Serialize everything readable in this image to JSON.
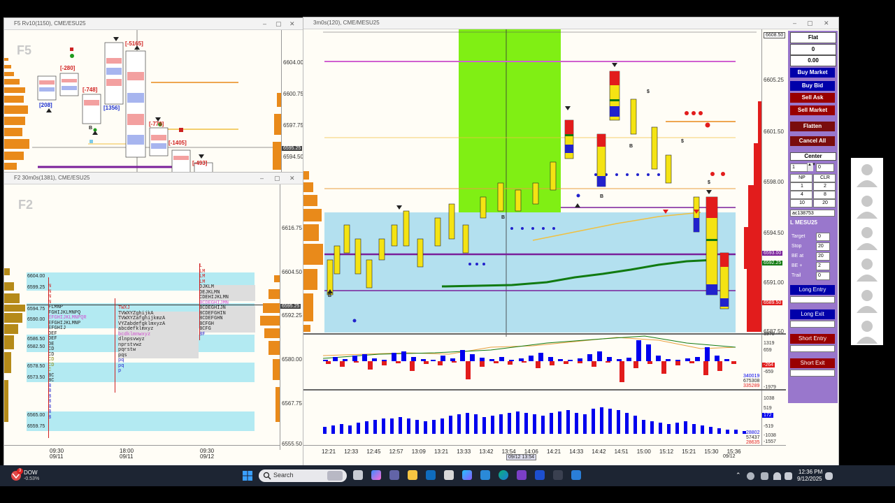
{
  "win_f5": {
    "title": "F5 Rv10(1150), CME/ESU25",
    "ghost": "F5",
    "axis": [
      "6604.00",
      "6600.75",
      "6597.75",
      "6594.50"
    ],
    "last_price": "6595.25",
    "labels": {
      "l208": "[208]",
      "l280": "[-280]",
      "l748": "[-748]",
      "l1356": "[1356]",
      "l5165": "[-5165]",
      "l779": "[-779]",
      "l1405": "[-1405]",
      "l493": "[-493]",
      "b": "B"
    }
  },
  "win_f2": {
    "title": "F2 30m0s(1381), CME/ESU25",
    "ghost": "F2",
    "axis": [
      "6616.75",
      "6604.50",
      "6592.25",
      "6580.00",
      "6567.75",
      "6555.50"
    ],
    "last_price": "6595.25",
    "price_levels": [
      "6604.00",
      "6599.25",
      "6594.75",
      "6590.00",
      "6586.50",
      "6582.50",
      "6578.50",
      "6573.50",
      "6565.00",
      "6559.75"
    ],
    "time_labels": [
      {
        "t": "09:30",
        "d": "09/11"
      },
      {
        "t": "18:00",
        "d": "09/11"
      },
      {
        "t": "09:30",
        "d": "09/12"
      }
    ],
    "tpo_col1": [
      "N",
      "N",
      "N",
      "N",
      "FLMNP",
      "FGHIJKLMNPQ",
      "EFGHIJKLMNPQR",
      "EFGHIJKLMNP",
      "EFGHIJ",
      "DEF",
      "DEF",
      "DE",
      "CD",
      "CD",
      "CD",
      "CD",
      "C",
      "BC",
      "BC",
      "B",
      "B",
      "B",
      "B",
      "B",
      "B",
      "B"
    ],
    "tpo_col2": [
      "TWXJ",
      "TVWXYZghijkA",
      "TVWXYZafghijkmzA",
      "VYZabdefgklmxyzA",
      "abcdefklmxyz",
      "bcdklmnwxyz",
      "dlnpsvwyz",
      "nprstvwz",
      "pqrstw",
      "pqs",
      "pq",
      "pq",
      "p"
    ],
    "tpo_col3": [
      "L",
      "LM",
      "LM",
      "LM",
      "DJKLM",
      "DEJKLMN",
      "CDEHIJKLMN",
      "BCDEGHIJMN",
      "BCDEGHIJN",
      "BCDEFGHIN",
      "BCDEFGHN",
      "BCFGH",
      "BCFG",
      "BF"
    ]
  },
  "win_main": {
    "title": "3m0s(120), CME/MESU25",
    "axis": [
      "6608.50",
      "6605.25",
      "6601.50",
      "6598.00",
      "6594.50",
      "6591.00",
      "6587.50"
    ],
    "price_tags": {
      "p1": "6593.00",
      "p2": "6592.25",
      "p3": "6589.50"
    },
    "osc1_axis": [
      "1978",
      "1319",
      "659",
      "-659",
      "-1319",
      "-1979"
    ],
    "osc1_tag": "-264",
    "osc1_vals": [
      "340019",
      "675308",
      "335289"
    ],
    "osc2_axis": [
      "1038",
      "519",
      "-519",
      "-1038",
      "-1557"
    ],
    "osc2_tag": "172",
    "osc2_vals": [
      "28802",
      "57437",
      "28635"
    ],
    "times": [
      "12:21",
      "12:33",
      "12:45",
      "12:57",
      "13:09",
      "13:21",
      "13:33",
      "13:42",
      "13:54",
      "14:06",
      "14:21",
      "14:33",
      "14:42",
      "14:51",
      "15:00",
      "15:12",
      "15:21",
      "15:30",
      "15:36"
    ],
    "date_end": "09/12",
    "cursor_time": "09/12 13:54",
    "markers": {
      "b": "B",
      "s": "$"
    }
  },
  "panel": {
    "position": "Flat",
    "qty": "0",
    "pnl": "0.00",
    "buy_market": "Buy Market",
    "buy_bid": "Buy Bid",
    "sell_ask": "Sell Ask",
    "sell_market": "Sell Market",
    "flatten": "Flatten",
    "cancel_all": "Cancel All",
    "center": "Center",
    "qty_a": "1",
    "qty_b": "0",
    "grid": [
      "NP",
      "CLR",
      "1",
      "2",
      "4",
      "8",
      "10",
      "20"
    ],
    "account": "ac138753",
    "instrument": "L MESU25",
    "fields": [
      {
        "label": "Target",
        "value": "0"
      },
      {
        "label": "Stop",
        "value": "20"
      },
      {
        "label": "BE at",
        "value": "20"
      },
      {
        "label": "BE +",
        "value": "2"
      },
      {
        "label": "Trail",
        "value": "0"
      }
    ],
    "long_entry": "Long Entry",
    "long_exit": "Long Exit",
    "short_entry": "Short Entry",
    "short_exit": "Short Exit"
  },
  "taskbar": {
    "ticker": "DOW",
    "change": "-0.53%",
    "badge": "3",
    "search": "Search",
    "time": "12:36 PM",
    "date": "9/12/2025"
  }
}
